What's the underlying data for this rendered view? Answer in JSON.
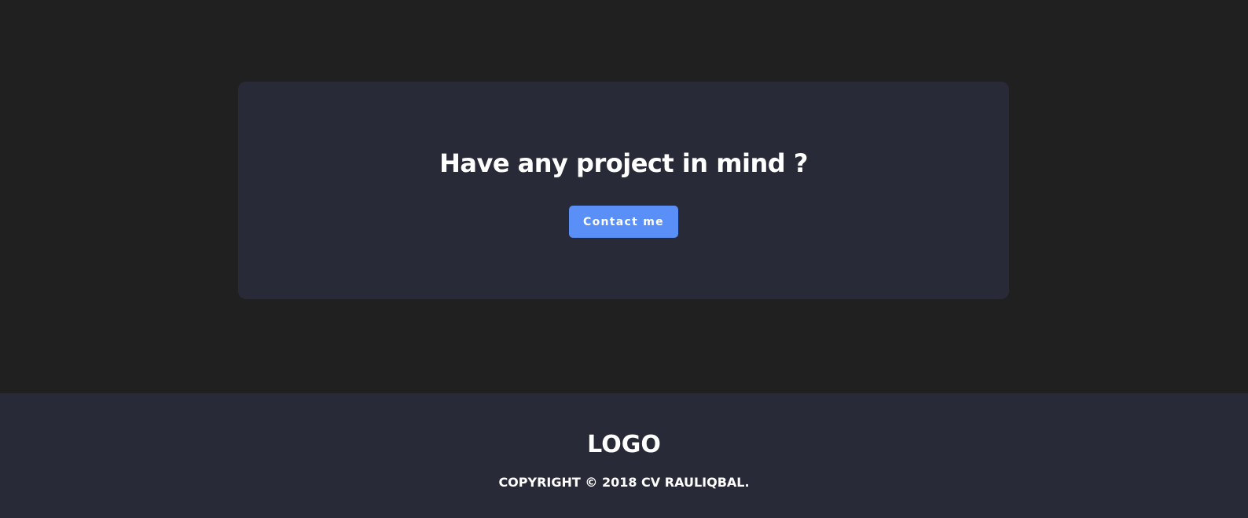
{
  "cta": {
    "heading": "Have any project in mind ?",
    "button_label": "Contact me"
  },
  "footer": {
    "logo_text": "LOGO",
    "copyright": "COPYRIGHT © 2018 CV RAULIQBAL."
  },
  "colors": {
    "page_background": "#202020",
    "card_background": "#292a37",
    "accent": "#5a8ff8",
    "text": "#ffffff"
  }
}
